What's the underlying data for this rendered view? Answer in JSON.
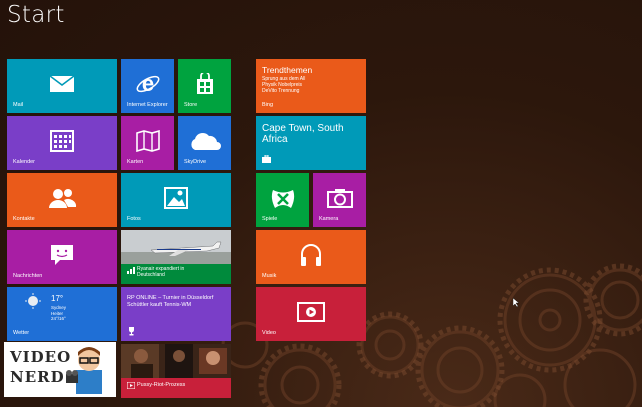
{
  "start": {
    "title": "Start"
  },
  "tiles": {
    "mail": {
      "label": "Mail",
      "color": "#009ab8",
      "icon": "mail-icon"
    },
    "ie": {
      "label": "Internet Explorer",
      "color": "#1f6fd6",
      "icon": "internet-explorer-icon"
    },
    "store": {
      "label": "Store",
      "color": "#00a33f",
      "icon": "store-icon"
    },
    "calendar": {
      "label": "Kalender",
      "color": "#7a3ec8",
      "icon": "calendar-icon"
    },
    "maps": {
      "label": "Karten",
      "color": "#a81ea4",
      "icon": "maps-icon"
    },
    "skydrive": {
      "label": "SkyDrive",
      "color": "#1f6fd6",
      "icon": "cloud-icon"
    },
    "contacts": {
      "label": "Kontakte",
      "color": "#ea5a1a",
      "icon": "people-icon"
    },
    "photos": {
      "label": "Fotos",
      "color": "#009ab8",
      "icon": "photos-icon"
    },
    "messages": {
      "label": "Nachrichten",
      "color": "#a81ea4",
      "icon": "messaging-icon"
    },
    "news_img": {
      "caption": "Ryanair expandiert in Deutschland",
      "color": "#008a3c",
      "icon": "news-icon"
    },
    "weather": {
      "label": "Wetter",
      "color": "#1f6fd6",
      "temp": "17°",
      "line1": "Sydney",
      "line2": "Heiter",
      "line3": "24°/16°",
      "icon": "sun-icon"
    },
    "sport": {
      "color": "#7a3ec8",
      "line1": "RP ONLINE – Turnier in Düsseldorf",
      "line2": "Schüttler kauft Tennis-WM",
      "icon": "trophy-icon"
    },
    "video_small": {
      "caption": "Pussy-Riot-Prozess",
      "color": "#c8203a"
    },
    "bing": {
      "label": "Bing",
      "color": "#ea5a1a",
      "head": "Trendthemen",
      "line1": "Sprung aus dem All",
      "line2": "Physik Nobelpreis",
      "line3": "DeVito Trennung"
    },
    "travel": {
      "city": "Cape Town, South Africa",
      "color": "#009ab8",
      "icon": "suitcase-icon"
    },
    "games": {
      "label": "Spiele",
      "color": "#00a33f",
      "icon": "gamepad-icon"
    },
    "camera": {
      "label": "Kamera",
      "color": "#a81ea4",
      "icon": "camera-icon"
    },
    "music": {
      "label": "Musik",
      "color": "#ea5a1a",
      "icon": "headphones-icon"
    },
    "video": {
      "label": "Video",
      "color": "#c8203a",
      "icon": "play-icon"
    }
  },
  "logo": {
    "word1": "VIDEO",
    "word2": "NERD"
  }
}
